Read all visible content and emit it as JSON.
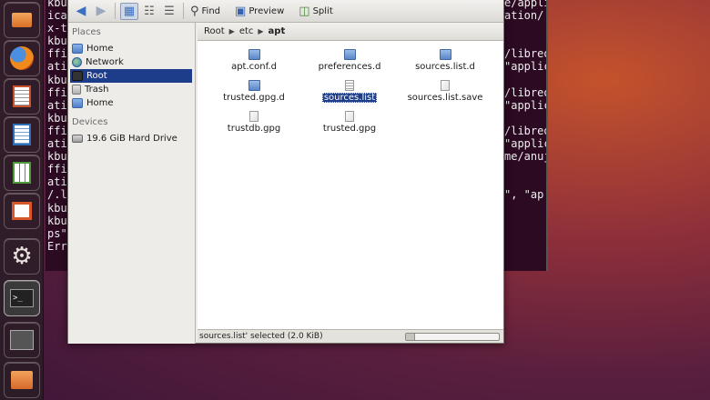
{
  "launcher": {
    "items": [
      {
        "name": "folder-icon",
        "glyph": "",
        "color": "#e8873b"
      },
      {
        "name": "firefox-icon",
        "glyph": "",
        "color": "#e46a1b"
      },
      {
        "name": "text-editor-icon",
        "glyph": "",
        "color": "#c8522b"
      },
      {
        "name": "writer-icon",
        "glyph": "",
        "color": "#2f6fb5"
      },
      {
        "name": "calc-icon",
        "glyph": "",
        "color": "#4c9a38"
      },
      {
        "name": "impress-icon",
        "glyph": "",
        "color": "#d8582a"
      },
      {
        "name": "settings-icon",
        "glyph": "⚙",
        "color": "#c9442c"
      },
      {
        "name": "terminal-icon",
        "glyph": "",
        "color": "#2b2b2b"
      },
      {
        "name": "workspace-switcher-icon",
        "glyph": "",
        "color": "#4a3a44"
      },
      {
        "name": "home-folder-icon",
        "glyph": "",
        "color": "#e07a35"
      }
    ]
  },
  "terminal": {
    "left_lines": [
      "kbu",
      "ica",
      "x-t",
      "kbu",
      "ffi",
      "ati",
      "kbu",
      "ffi",
      "ati",
      "kbu",
      "ffi",
      "ati",
      "kbu",
      "ffi",
      "ati",
      "/.l",
      "kbu",
      "kbu",
      "ps\"",
      "Erro"
    ],
    "right_lines": [
      "e/appli",
      "ation/",
      "",
      "",
      "/libreo",
      "\"applic",
      "",
      "/libreo",
      "\"applic",
      "",
      "/libreo",
      "\"applic",
      "me/anuj",
      "",
      "",
      "\", \"ap",
      "",
      "",
      ""
    ]
  },
  "file_manager": {
    "toolbar": {
      "find_label": "Find",
      "preview_label": "Preview",
      "split_label": "Split"
    },
    "sidebar": {
      "places_heading": "Places",
      "places": [
        {
          "label": "Home",
          "icon": "home-icon"
        },
        {
          "label": "Network",
          "icon": "network-icon"
        },
        {
          "label": "Root",
          "icon": "root-icon",
          "selected": true
        },
        {
          "label": "Trash",
          "icon": "trash-icon"
        },
        {
          "label": "Home",
          "icon": "home-icon"
        }
      ],
      "devices_heading": "Devices",
      "devices": [
        {
          "label": "19.6 GiB Hard Drive",
          "icon": "hard-drive-icon"
        }
      ]
    },
    "breadcrumb": [
      "Root",
      "etc",
      "apt"
    ],
    "files": [
      {
        "label": "apt.conf.d",
        "type": "folder"
      },
      {
        "label": "preferences.d",
        "type": "folder"
      },
      {
        "label": "sources.list.d",
        "type": "folder"
      },
      {
        "label": "trusted.gpg.d",
        "type": "folder"
      },
      {
        "label": "sources.list",
        "type": "text",
        "selected": true
      },
      {
        "label": "sources.list.save",
        "type": "file"
      },
      {
        "label": "trustdb.gpg",
        "type": "file"
      },
      {
        "label": "trusted.gpg",
        "type": "file"
      }
    ],
    "status_text": "sources.list' selected (2.0 KiB)"
  }
}
